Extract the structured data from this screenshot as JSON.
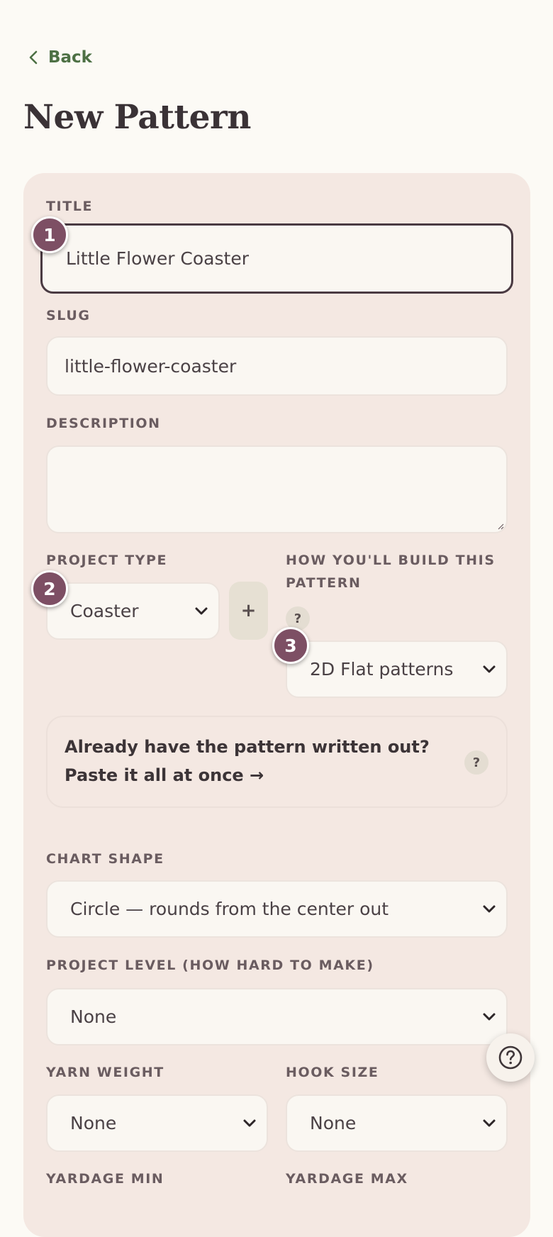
{
  "nav": {
    "back_label": "Back"
  },
  "page": {
    "title": "New Pattern"
  },
  "form": {
    "title": {
      "label": "TITLE",
      "value": "Little Flower Coaster"
    },
    "slug": {
      "label": "SLUG",
      "value": "little-flower-coaster"
    },
    "description": {
      "label": "DESCRIPTION",
      "value": ""
    },
    "project_type": {
      "label": "PROJECT TYPE",
      "value": "Coaster",
      "add_label": "+"
    },
    "build_method": {
      "label_line1": "HOW YOU'LL BUILD THIS",
      "label_line2": "PATTERN",
      "help": "?",
      "value": "2D Flat patterns"
    },
    "paste": {
      "line1": "Already have the pattern written out?",
      "line2": "Paste it all at once →",
      "help": "?"
    },
    "chart_shape": {
      "label": "CHART SHAPE",
      "value": "Circle — rounds from the center out"
    },
    "project_level": {
      "label": "PROJECT LEVEL (HOW HARD TO MAKE)",
      "value": "None"
    },
    "yarn_weight": {
      "label": "YARN WEIGHT",
      "value": "None"
    },
    "hook_size": {
      "label": "HOOK SIZE",
      "value": "None"
    },
    "yardage_min": {
      "label": "YARDAGE MIN"
    },
    "yardage_max": {
      "label": "YARDAGE MAX"
    }
  },
  "badges": {
    "one": "1",
    "two": "2",
    "three": "3"
  },
  "colors": {
    "accent": "#7d4f64",
    "back_link": "#4d7044",
    "card": "#f4e8e2",
    "page": "#fcfaf5"
  }
}
